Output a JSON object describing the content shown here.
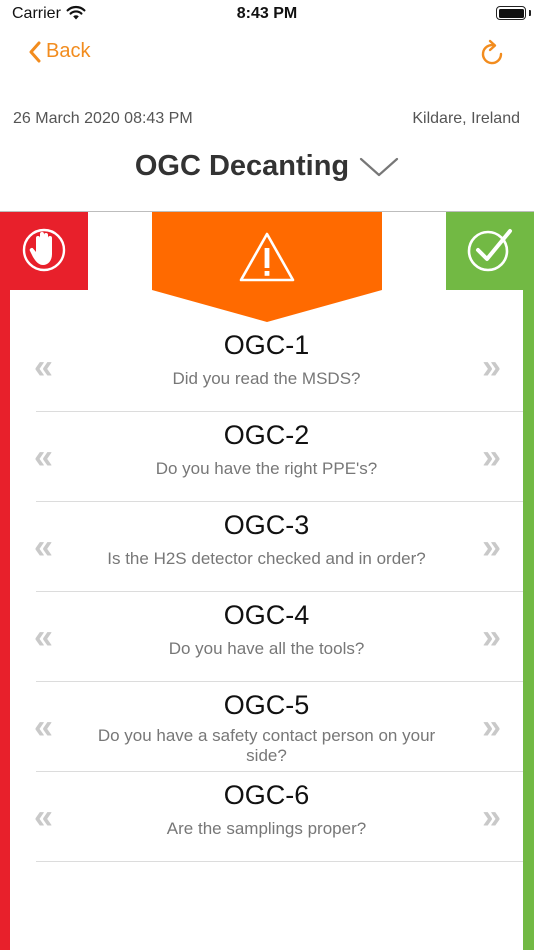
{
  "status_bar": {
    "carrier": "Carrier",
    "time": "8:43 PM",
    "icons": [
      "wifi-icon",
      "battery-icon"
    ]
  },
  "nav": {
    "back_label": "Back",
    "accent_color": "#f28c1e",
    "icons": [
      "chevron-left-icon",
      "refresh-icon"
    ]
  },
  "header": {
    "date": "26 March 2020 08:43 PM",
    "location": "Kildare, Ireland",
    "title": "OGC Decanting",
    "icons": [
      "chevron-down-icon"
    ]
  },
  "colors": {
    "reject": "#e8202b",
    "accept": "#72b944",
    "warning": "#ff6a00"
  },
  "status_icons": [
    "stop-hand-icon",
    "warning-icon",
    "check-circle-icon"
  ],
  "arrow_glyphs": {
    "left": "«",
    "right": "»"
  },
  "checklist": [
    {
      "code": "OGC-1",
      "question": "Did you read the MSDS?"
    },
    {
      "code": "OGC-2",
      "question": "Do you have the right PPE's?"
    },
    {
      "code": "OGC-3",
      "question": "Is the H2S detector checked and in order?"
    },
    {
      "code": "OGC-4",
      "question": "Do you have all the tools?"
    },
    {
      "code": "OGC-5",
      "question": "Do you have a safety contact person on your side?"
    },
    {
      "code": "OGC-6",
      "question": "Are the samplings proper?"
    }
  ]
}
